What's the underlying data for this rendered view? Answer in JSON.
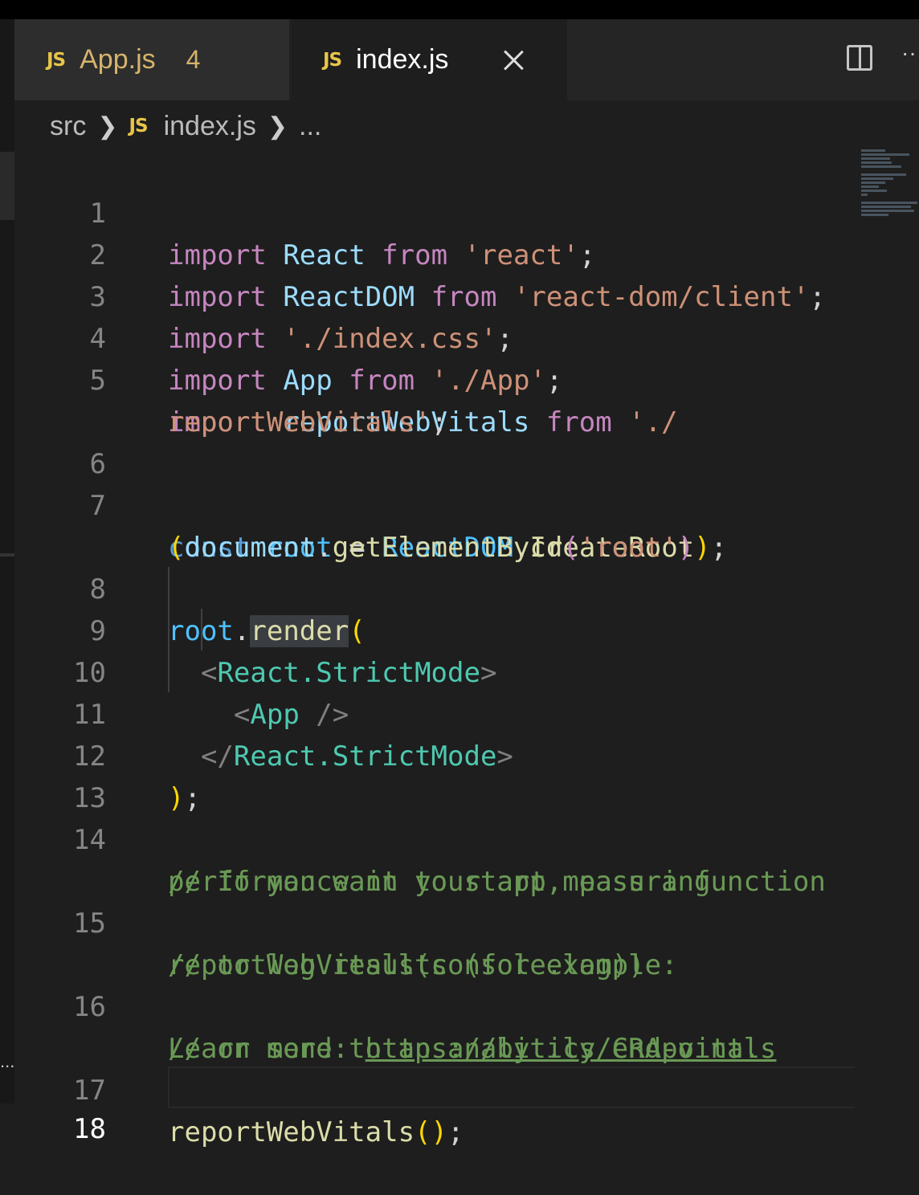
{
  "tabs": [
    {
      "label": "App.js",
      "badge": "JS",
      "problems": "4"
    },
    {
      "label": "index.js",
      "badge": "JS"
    }
  ],
  "breadcrumb": {
    "folder": "src",
    "file": "index.js",
    "badge": "JS",
    "more": "..."
  },
  "toolbar": {
    "more_label": "··"
  },
  "sidebar": {
    "ellipsis": "..."
  },
  "line_numbers": [
    "1",
    "2",
    "3",
    "4",
    "5",
    "6",
    "7",
    "8",
    "9",
    "10",
    "11",
    "12",
    "13",
    "14",
    "15",
    "16",
    "17",
    "18"
  ],
  "code": {
    "l1": [
      "import",
      "React",
      "from",
      "'react'",
      ";"
    ],
    "l2": [
      "import",
      "ReactDOM",
      "from",
      "'react-dom/client'",
      ";"
    ],
    "l3": [
      "import",
      "'./index.css'",
      ";"
    ],
    "l4": [
      "import",
      "App",
      "from",
      "'./App'",
      ";"
    ],
    "l5": [
      "import",
      "reportWebVitals",
      "from",
      "'./"
    ],
    "l5b": [
      "reportWebVitals'",
      ";"
    ],
    "l7": [
      "const",
      "root",
      "=",
      "ReactDOM",
      ".",
      "createRoot"
    ],
    "l7b": [
      "(",
      "document",
      ".",
      "getElementById",
      "(",
      "'root'",
      ")",
      ")",
      ";"
    ],
    "l8": [
      "root",
      ".",
      "render",
      "("
    ],
    "l9": [
      "<",
      "React.StrictMode",
      ">"
    ],
    "l10": [
      "<",
      "App",
      " />"
    ],
    "l11": [
      "</",
      "React.StrictMode",
      ">"
    ],
    "l12": [
      ")",
      ";"
    ],
    "l14": "// If you want to start measuring",
    "l14b": "performance in your app, pass a function",
    "l15": "// to log results (for example:",
    "l15b": "reportWebVitals(console.log))",
    "l16": "// or send to an analytics endpoint.",
    "l16b_text": "Learn more: ",
    "l16b_link": "https://bit.ly/CRA-vitals",
    "l17": [
      "reportWebVitals",
      "(",
      ")",
      ";"
    ]
  },
  "colors": {
    "background": "#1e1e1e",
    "keyword": "#c586c0",
    "identifier": "#9cdcfe",
    "string": "#ce9178",
    "function": "#dcdcaa",
    "comment": "#6a9955",
    "type": "#4ec9b0",
    "tab_warning": "#d7b36b"
  }
}
